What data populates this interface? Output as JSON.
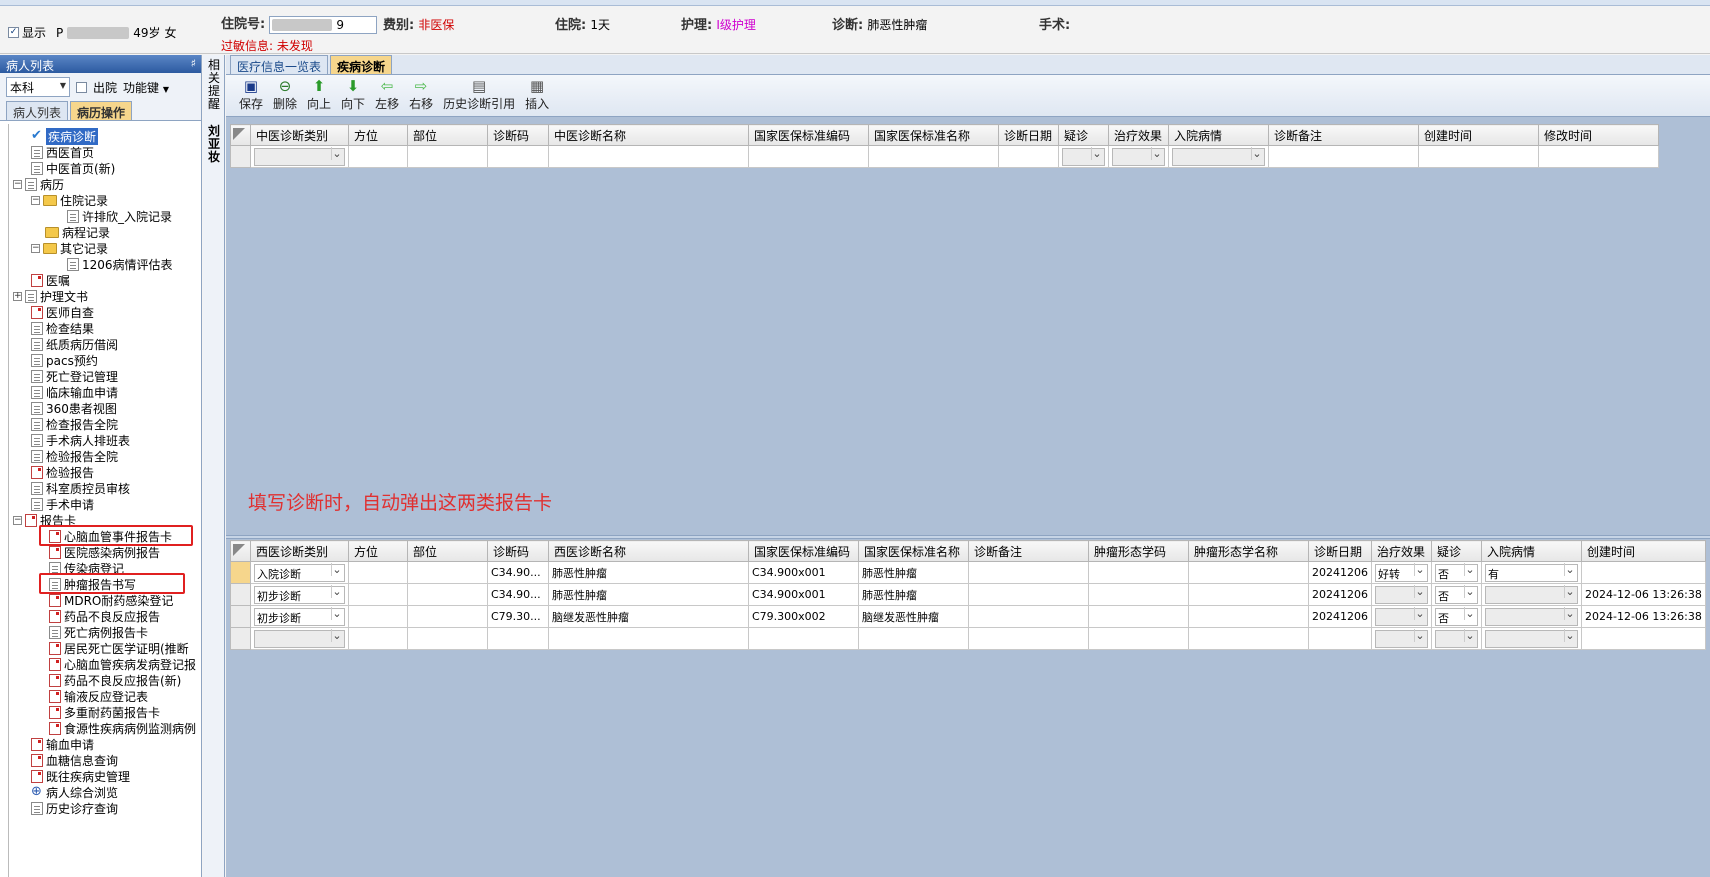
{
  "info": {
    "show_label": "显示",
    "patient_prefix": "P",
    "patient_age": "49岁",
    "patient_sex": "女",
    "admission_no_label": "住院号:",
    "admission_no_value": "9",
    "fee_label": "费别:",
    "fee_value": "非医保",
    "stay_label": "住院:",
    "stay_value": "1天",
    "nursing_label": "护理:",
    "nursing_value": "I级护理",
    "diagnosis_label": "诊断:",
    "diagnosis_value": "肺恶性肿瘤",
    "surgery_label": "手术:",
    "allergy_text": "过敏信息: 未发现"
  },
  "left_panel": {
    "title": "病人列表",
    "pin": "♯",
    "dept_select": "本科",
    "discharged_label": "出院",
    "func_key_label": "功能键",
    "tabs": [
      "病人列表",
      "病历操作"
    ],
    "tree": {
      "disease_diag": "疾病诊断",
      "western_front": "西医首页",
      "tcm_front_new": "中医首页(新)",
      "medical_record": "病历",
      "admission_record": "住院记录",
      "admission_entry": "许排欣_入院记录",
      "progress_record": "病程记录",
      "other_record": "其它记录",
      "assessment_1206": "1206病情评估表",
      "orders": "医嘱",
      "nursing_docs": "护理文书",
      "doctor_self_check": "医师自查",
      "exam_results": "检查结果",
      "paper_record_borrow": "纸质病历借阅",
      "pacs_booking": "pacs预约",
      "death_registration": "死亡登记管理",
      "clinical_transfusion": "临床输血申请",
      "view_360": "360患者视图",
      "exam_report_hospital": "检查报告全院",
      "surgery_schedule": "手术病人排班表",
      "lab_report_hospital": "检验报告全院",
      "lab_report": "检验报告",
      "qc_review": "科室质控员审核",
      "surgery_request": "手术申请",
      "report_card": "报告卡",
      "cardio_event_card": "心脑血管事件报告卡",
      "infection_report": "医院感染病例报告",
      "infectious_reg": "传染病登记",
      "tumor_report": "肿瘤报告书写",
      "mdro_reg": "MDRO耐药感染登记",
      "adr_report": "药品不良反应报告",
      "death_case_card": "死亡病例报告卡",
      "resident_death": "居民死亡医学证明(推断",
      "cardio_onset_reg": "心脑血管疾病发病登记报",
      "adr_report_new": "药品不良反应报告(新)",
      "transfusion_reaction": "输液反应登记表",
      "multidrug_card": "多重耐药菌报告卡",
      "foodborne_monitor": "食源性疾病病例监测病例",
      "blood_request": "输血申请",
      "glucose_query": "血糖信息查询",
      "history_mgmt": "既往疾病史管理",
      "patient_overview": "病人综合浏览",
      "history_query": "历史诊疗查询"
    }
  },
  "side_strip": {
    "top_text": [
      "相",
      "关",
      "提",
      "醒"
    ],
    "name_text": [
      "刘",
      "亚",
      "妆"
    ]
  },
  "main": {
    "tabs": [
      "医疗信息一览表",
      "疾病诊断"
    ],
    "toolbar": [
      "保存",
      "删除",
      "向上",
      "向下",
      "左移",
      "右移",
      "历史诊断引用",
      "插入"
    ],
    "tcm_grid": {
      "headers": [
        "中医诊断类别",
        "方位",
        "部位",
        "诊断码",
        "中医诊断名称",
        "国家医保标准编码",
        "国家医保标准名称",
        "诊断日期",
        "疑诊",
        "治疗效果",
        "入院病情",
        "诊断备注",
        "创建时间",
        "修改时间"
      ]
    },
    "annotation": "填写诊断时，自动弹出这两类报告卡",
    "western_grid": {
      "headers": [
        "西医诊断类别",
        "方位",
        "部位",
        "诊断码",
        "西医诊断名称",
        "国家医保标准编码",
        "国家医保标准名称",
        "诊断备注",
        "肿瘤形态学码",
        "肿瘤形态学名称",
        "诊断日期",
        "治疗效果",
        "疑诊",
        "入院病情",
        "创建时间"
      ],
      "rows": [
        {
          "category": "入院诊断",
          "code": "C34.90...",
          "name": "肺恶性肿瘤",
          "ins_code": "C34.900x001",
          "ins_name": "肺恶性肿瘤",
          "date": "20241206",
          "effect": "好转",
          "suspect": "否",
          "admit": "有",
          "created": ""
        },
        {
          "category": "初步诊断",
          "code": "C34.90...",
          "name": "肺恶性肿瘤",
          "ins_code": "C34.900x001",
          "ins_name": "肺恶性肿瘤",
          "date": "20241206",
          "effect": "",
          "suspect": "否",
          "admit": "",
          "created": "2024-12-06 13:26:38"
        },
        {
          "category": "初步诊断",
          "code": "C79.30...",
          "name": "脑继发恶性肿瘤",
          "ins_code": "C79.300x002",
          "ins_name": "脑继发恶性肿瘤",
          "date": "20241206",
          "effect": "",
          "suspect": "否",
          "admit": "",
          "created": "2024-12-06 13:26:38"
        }
      ]
    }
  }
}
